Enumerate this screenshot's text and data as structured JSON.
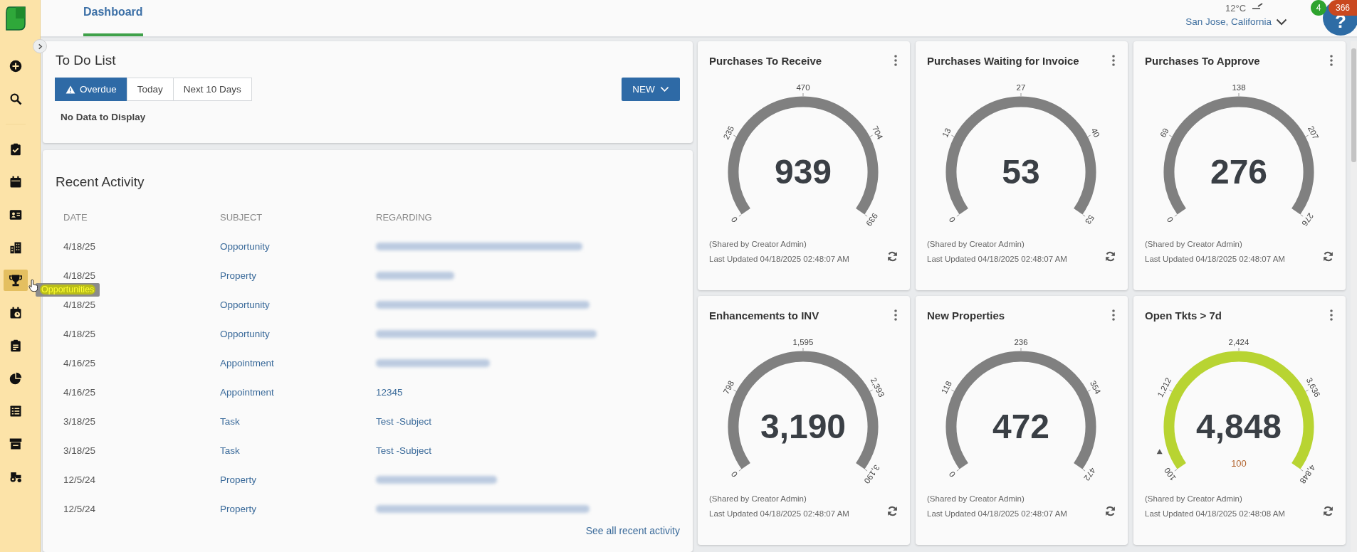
{
  "sidebar": {
    "items": [
      {
        "selected": false
      },
      {
        "selected": false
      },
      {
        "selected": false
      },
      {
        "selected": false
      },
      {
        "selected": false
      },
      {
        "selected": false
      },
      {
        "selected": true
      },
      {
        "selected": false
      },
      {
        "selected": false
      },
      {
        "selected": false
      },
      {
        "selected": false
      },
      {
        "selected": false
      },
      {
        "selected": false
      }
    ],
    "tooltip": "Opportunities"
  },
  "header": {
    "tabs": [
      {
        "label": "Dashboard",
        "selected": true
      }
    ],
    "weather": {
      "temperature": "12°C",
      "location": "San Jose, California"
    },
    "help": {
      "symbol": "?",
      "badges": [
        {
          "text": "4",
          "color": "#2ea32e"
        },
        {
          "text": "366",
          "color": "#c9481f"
        }
      ]
    }
  },
  "todo": {
    "title": "To Do List",
    "filters": [
      {
        "label": "Overdue",
        "selected": true
      },
      {
        "label": "Today",
        "selected": false
      },
      {
        "label": "Next 10 Days",
        "selected": false
      }
    ],
    "new_button": "NEW",
    "empty_message": "No Data to Display"
  },
  "recent_activity": {
    "title": "Recent Activity",
    "columns": [
      "DATE",
      "SUBJECT",
      "REGARDING"
    ],
    "rows": [
      {
        "date": "4/18/25",
        "subject": "Opportunity",
        "blurred": true
      },
      {
        "date": "4/18/25",
        "subject": "Property",
        "blurred": true
      },
      {
        "date": "4/18/25",
        "subject": "Opportunity",
        "blurred": true
      },
      {
        "date": "4/18/25",
        "subject": "Opportunity",
        "blurred": true
      },
      {
        "date": "4/16/25",
        "subject": "Appointment",
        "blurred": true
      },
      {
        "date": "4/16/25",
        "subject": "Appointment",
        "blurred": false,
        "regarding": "12345"
      },
      {
        "date": "3/18/25",
        "subject": "Task",
        "blurred": false,
        "regarding": "Test -Subject"
      },
      {
        "date": "3/18/25",
        "subject": "Task",
        "blurred": false,
        "regarding": "Test -Subject"
      },
      {
        "date": "12/5/24",
        "subject": "Property",
        "blurred": true
      },
      {
        "date": "12/5/24",
        "subject": "Property",
        "blurred": true
      }
    ],
    "link": "See all recent activity"
  },
  "gauges": [
    {
      "title": "Purchases To Receive",
      "value": "939",
      "ticks": [
        "0",
        "235",
        "470",
        "704",
        "939"
      ],
      "color": "#808080",
      "shared": "(Shared by Creator Admin)",
      "updated": "Last Updated 04/18/2025 02:48:07 AM"
    },
    {
      "title": "Purchases Waiting for Invoice",
      "value": "53",
      "ticks": [
        "0",
        "13",
        "27",
        "40",
        "53"
      ],
      "color": "#808080",
      "shared": "(Shared by Creator Admin)",
      "updated": "Last Updated 04/18/2025 02:48:07 AM"
    },
    {
      "title": "Purchases To Approve",
      "value": "276",
      "ticks": [
        "0",
        "69",
        "138",
        "207",
        "276"
      ],
      "color": "#808080",
      "shared": "(Shared by Creator Admin)",
      "updated": "Last Updated 04/18/2025 02:48:07 AM"
    },
    {
      "title": "Enhancements to INV",
      "value": "3,190",
      "ticks": [
        "0",
        "798",
        "1,595",
        "2,393",
        "3,190"
      ],
      "color": "#808080",
      "shared": "(Shared by Creator Admin)",
      "updated": "Last Updated 04/18/2025 02:48:07 AM"
    },
    {
      "title": "New Properties",
      "value": "472",
      "ticks": [
        "0",
        "118",
        "236",
        "354",
        "472"
      ],
      "color": "#808080",
      "shared": "(Shared by Creator Admin)",
      "updated": "Last Updated 04/18/2025 02:48:07 AM"
    },
    {
      "title": "Open Tkts > 7d",
      "value": "4,848",
      "ticks": [
        "100",
        "1,212",
        "2,424",
        "3,636",
        "4,848"
      ],
      "color": "#b8d432",
      "target": "100",
      "shared": "(Shared by Creator Admin)",
      "updated": "Last Updated 04/18/2025 02:48:08 AM"
    }
  ]
}
